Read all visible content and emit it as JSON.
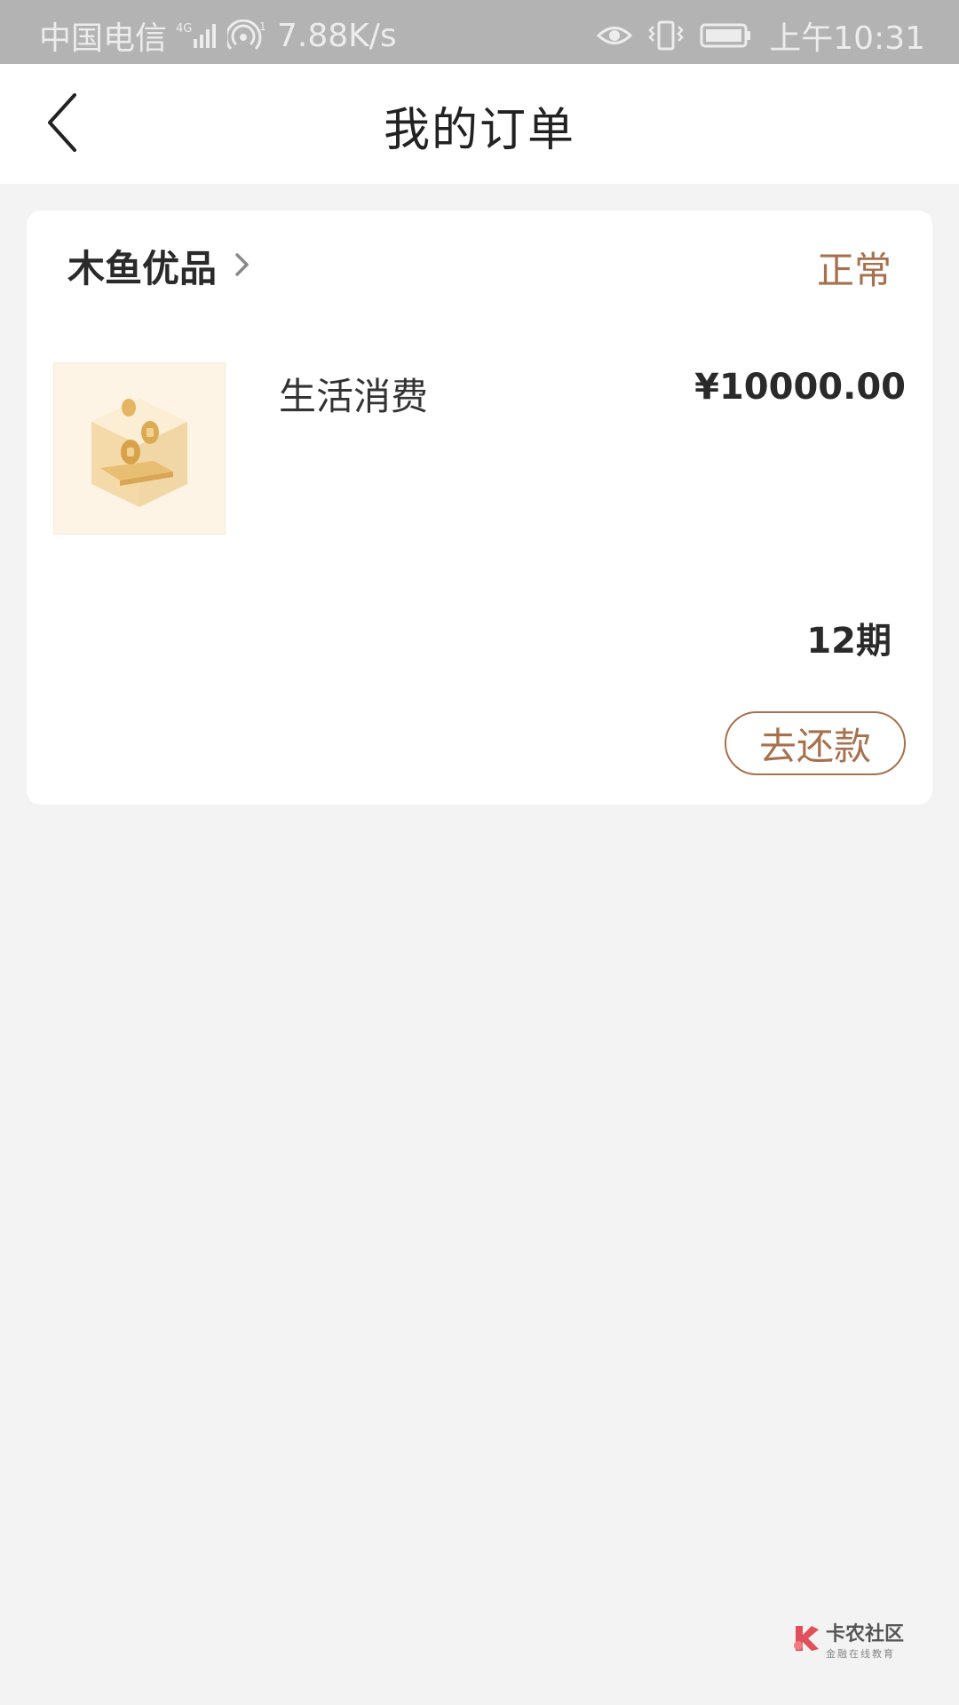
{
  "status_bar": {
    "carrier": "中国电信",
    "network_speed": "7.88K/s",
    "time": "上午10:31",
    "icons": [
      "signal-4g-icon",
      "hotspot-icon",
      "eye-icon",
      "vibrate-icon",
      "battery-icon"
    ]
  },
  "nav": {
    "title": "我的订单",
    "back_icon": "chevron-left-icon"
  },
  "order": {
    "shop_name": "木鱼优品",
    "status": "正常",
    "product": {
      "name": "生活消费",
      "price": "¥10000.00",
      "thumb_icon": "coin-box-icon"
    },
    "installments": "12期",
    "repay_label": "去还款"
  },
  "watermark": {
    "title": "卡农社区",
    "subtitle": "金融在线教育"
  },
  "colors": {
    "accent": "#a7714e",
    "background": "#f3f3f3",
    "status_bar": "#b3b3b3"
  }
}
